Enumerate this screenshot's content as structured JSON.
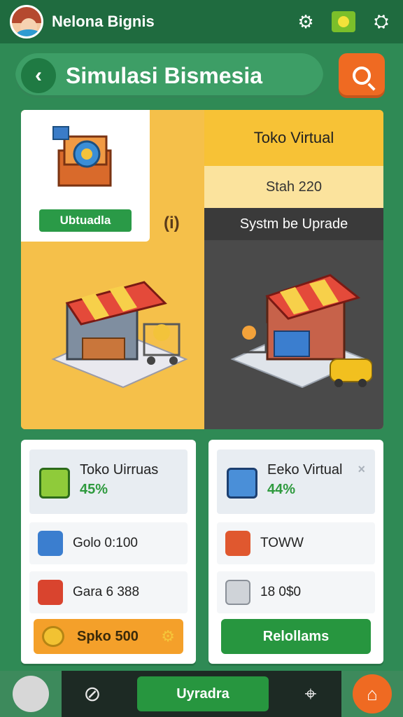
{
  "header": {
    "username": "Nelona Bignis",
    "icons": [
      "avatar",
      "gear-icon",
      "badge-icon",
      "menu-icon"
    ]
  },
  "title_bar": {
    "back_icon": "chevron-left-icon",
    "title": "Simulasi Bismesia",
    "search_icon": "search-icon"
  },
  "hero": {
    "upload_label": "Ubtuadla",
    "virtual_title": "Toko Virtual",
    "virtual_price": "Stah 220",
    "system_label": "Systm be Uprade",
    "mid_glyph": "(i)"
  },
  "cards": [
    {
      "title": "Toko Uirruas",
      "percent": "45%",
      "row1": "Golo 0:100",
      "row2": "Gara 6 388",
      "button": "Spko 500"
    },
    {
      "title": "Eeko Virtual",
      "percent": "44%",
      "row1": "TOWW",
      "row2": "18 0$0",
      "button": "Relollams"
    }
  ],
  "bottom_nav": {
    "main_label": "Uyradra",
    "icons": [
      "profile-icon",
      "compass-icon",
      "target-icon",
      "home-icon"
    ]
  },
  "colors": {
    "primary_green": "#2f8a55",
    "dark_green": "#1f6b3f",
    "accent_orange": "#ef6a22",
    "hero_yellow": "#f5c04a",
    "button_green": "#27963f"
  }
}
